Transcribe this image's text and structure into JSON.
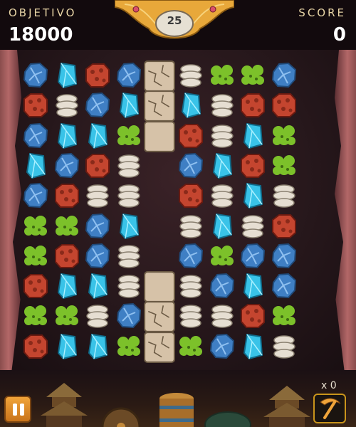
{
  "hud": {
    "goal_label": "OBJETIVO",
    "goal_value": "18000",
    "score_label": "SCORE",
    "score_value": "0",
    "moves_left": "25"
  },
  "powerups": {
    "pickaxe_count": "x 0"
  },
  "colors": {
    "blue_rock": "#3f7fc4",
    "cyan_crystal": "#39c3e8",
    "red_ore": "#c4452f",
    "white_fossil": "#e6ded2",
    "green_moss": "#7cc12a",
    "stone_block": "#d6c2a8",
    "accent_gold": "#e8a83a"
  },
  "board": {
    "cols": 9,
    "rows": 10,
    "legend": {
      "B": "blue-rock",
      "C": "cyan-crystal",
      "R": "red-ore",
      "W": "white-fossil",
      "G": "green-moss",
      "S": "stone-block",
      "K": "cracked-stone-block",
      "X": "empty"
    },
    "grid": [
      [
        "B",
        "C",
        "R",
        "B",
        "K",
        "W",
        "G",
        "G",
        "B"
      ],
      [
        "R",
        "W",
        "B",
        "C",
        "K",
        "C",
        "W",
        "R",
        "R"
      ],
      [
        "B",
        "C",
        "C",
        "G",
        "S",
        "R",
        "W",
        "C",
        "G"
      ],
      [
        "C",
        "B",
        "R",
        "W",
        "X",
        "B",
        "C",
        "R",
        "G"
      ],
      [
        "B",
        "R",
        "W",
        "W",
        "X",
        "R",
        "W",
        "C",
        "W"
      ],
      [
        "G",
        "G",
        "B",
        "C",
        "X",
        "W",
        "C",
        "W",
        "R"
      ],
      [
        "G",
        "R",
        "B",
        "W",
        "X",
        "B",
        "G",
        "B",
        "B"
      ],
      [
        "R",
        "C",
        "C",
        "W",
        "S",
        "W",
        "B",
        "C",
        "B"
      ],
      [
        "G",
        "G",
        "W",
        "B",
        "K",
        "W",
        "W",
        "R",
        "G"
      ],
      [
        "R",
        "C",
        "C",
        "G",
        "K",
        "G",
        "B",
        "C",
        "W"
      ]
    ]
  }
}
